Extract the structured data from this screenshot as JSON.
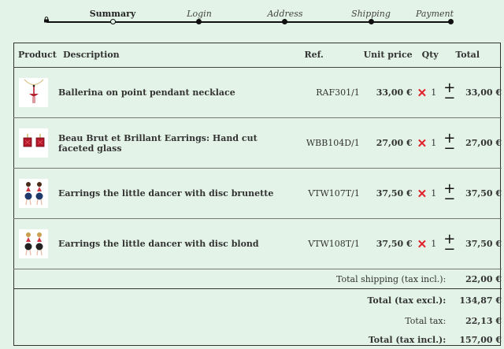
{
  "steps": [
    {
      "label": "Summary",
      "state": "current"
    },
    {
      "label": "Login",
      "state": "future"
    },
    {
      "label": "Address",
      "state": "future"
    },
    {
      "label": "Shipping",
      "state": "future"
    },
    {
      "label": "Payment",
      "state": "future"
    }
  ],
  "table": {
    "headers": {
      "product": "Product",
      "description": "Description",
      "ref": "Ref.",
      "unit_price": "Unit price",
      "qty": "Qty",
      "total": "Total"
    },
    "items": [
      {
        "description": "Ballerina on point pendant necklace",
        "ref": "RAF301/1",
        "unit_price": "33,00 €",
        "qty": "1",
        "total": "33,00 €",
        "image": "necklace-icon"
      },
      {
        "description": "Beau Brut et Brillant Earrings: Hand cut faceted glass",
        "ref": "WBB104D/1",
        "unit_price": "27,00 €",
        "qty": "1",
        "total": "27,00 €",
        "image": "red-earrings-icon"
      },
      {
        "description": "Earrings the little dancer with disc brunette",
        "ref": "VTW107T/1",
        "unit_price": "37,50 €",
        "qty": "1",
        "total": "37,50 €",
        "image": "dancer-earrings-icon"
      },
      {
        "description": "Earrings the little dancer with disc blond",
        "ref": "VTW108T/1",
        "unit_price": "37,50 €",
        "qty": "1",
        "total": "37,50 €",
        "image": "dancer-earrings-icon"
      }
    ],
    "remove_symbol": "✕",
    "plus_symbol": "+",
    "minus_symbol": "−"
  },
  "totals": {
    "shipping_label": "Total shipping (tax incl.):",
    "shipping_value": "22,00 €",
    "excl_label": "Total (tax excl.):",
    "excl_value": "134,87 €",
    "tax_label": "Total tax:",
    "tax_value": "22,13 €",
    "incl_label": "Total (tax incl.):",
    "incl_value": "157,00 €"
  }
}
